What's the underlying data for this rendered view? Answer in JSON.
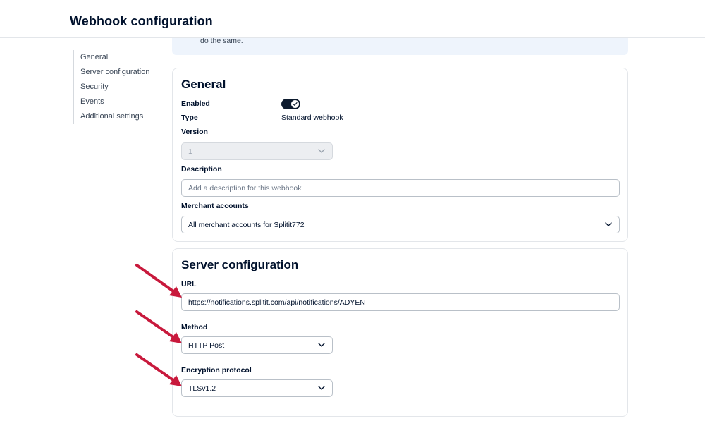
{
  "header": {
    "title": "Webhook configuration"
  },
  "nav": {
    "items": [
      {
        "label": "General"
      },
      {
        "label": "Server configuration"
      },
      {
        "label": "Security"
      },
      {
        "label": "Events"
      },
      {
        "label": "Additional settings"
      }
    ]
  },
  "banner": {
    "text": "do the same."
  },
  "general": {
    "title": "General",
    "enabled_label": "Enabled",
    "enabled": true,
    "type_label": "Type",
    "type_value": "Standard webhook",
    "version_label": "Version",
    "version_value": "1",
    "description_label": "Description",
    "description_placeholder": "Add a description for this webhook",
    "merchant_label": "Merchant accounts",
    "merchant_value": "All merchant accounts for Splitit772"
  },
  "server": {
    "title": "Server configuration",
    "url_label": "URL",
    "url_value": "https://notifications.splitit.com/api/notifications/ADYEN",
    "method_label": "Method",
    "method_value": "HTTP Post",
    "encryption_label": "Encryption protocol",
    "encryption_value": "TLSv1.2"
  },
  "colors": {
    "annotation_arrow": "#c8193c",
    "toggle_on": "#0d1b2e",
    "banner_bg": "#eef4fc"
  }
}
